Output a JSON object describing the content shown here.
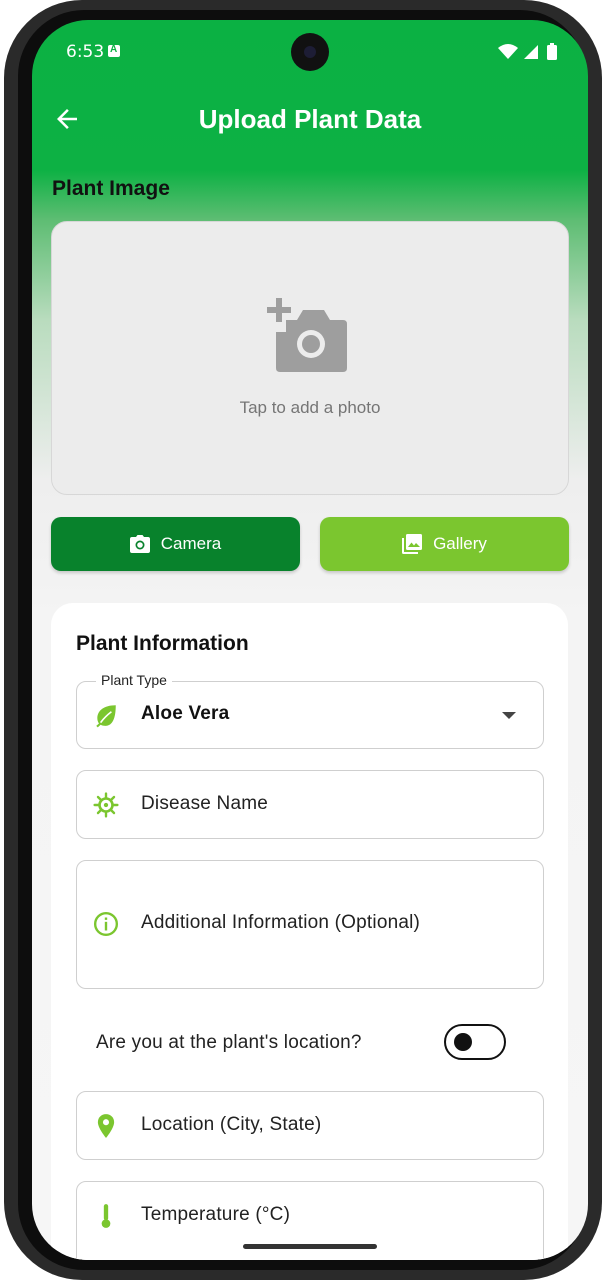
{
  "status_bar": {
    "time": "6:53"
  },
  "app_bar": {
    "title": "Upload Plant Data"
  },
  "image_section": {
    "label": "Plant Image",
    "placeholder_text": "Tap to add a photo",
    "icon": "add-a-photo-icon"
  },
  "buttons": {
    "camera_label": "Camera",
    "gallery_label": "Gallery"
  },
  "form": {
    "title": "Plant Information",
    "plant_type": {
      "label": "Plant Type",
      "value": "Aloe Vera",
      "icon": "leaf-icon"
    },
    "disease_name": {
      "placeholder": "Disease Name",
      "icon": "virus-icon"
    },
    "additional_info": {
      "placeholder": "Additional Information (Optional)",
      "icon": "info-icon"
    },
    "at_location": {
      "label": "Are you at the plant's location?",
      "on": false
    },
    "location": {
      "placeholder": "Location (City, State)",
      "icon": "location-pin-icon"
    },
    "temperature": {
      "placeholder": "Temperature (°C)",
      "icon": "thermometer-icon"
    }
  },
  "colors": {
    "primary": "#0bb143",
    "camera_button": "#08822c",
    "gallery_button": "#7bc62f",
    "icon_green": "#7bc62f"
  }
}
